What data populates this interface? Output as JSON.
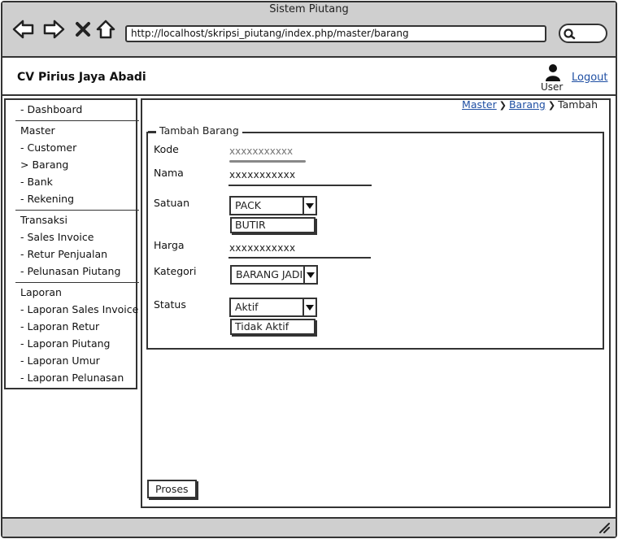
{
  "window": {
    "title": "Sistem Piutang"
  },
  "browser": {
    "url": "http://localhost/skripsi_piutang/index.php/master/barang"
  },
  "header": {
    "brand": "CV Pirius Jaya Abadi",
    "user_label": "User",
    "logout_label": "Logout"
  },
  "breadcrumb": {
    "items": [
      "Master",
      "Barang",
      "Tambah"
    ]
  },
  "sidebar": {
    "dashboard": "- Dashboard",
    "master": {
      "header": "Master",
      "items": [
        "- Customer",
        "> Barang",
        "- Bank",
        "- Rekening"
      ]
    },
    "transaksi": {
      "header": "Transaksi",
      "items": [
        "- Sales Invoice",
        "- Retur Penjualan",
        "- Pelunasan Piutang"
      ]
    },
    "laporan": {
      "header": "Laporan",
      "items": [
        "- Laporan Sales Invoice",
        "- Laporan Retur",
        "- Laporan Piutang",
        "- Laporan Umur",
        "- Laporan Pelunasan"
      ]
    }
  },
  "form": {
    "legend": "Tambah Barang",
    "kode": {
      "label": "Kode",
      "placeholder": "xxxxxxxxxxx"
    },
    "nama": {
      "label": "Nama",
      "value": "xxxxxxxxxxx"
    },
    "satuan": {
      "label": "Satuan",
      "selected": "PACK",
      "options": [
        "BUTIR"
      ]
    },
    "harga": {
      "label": "Harga",
      "value": "xxxxxxxxxxx"
    },
    "kategori": {
      "label": "Kategori",
      "selected": "BARANG JADI"
    },
    "status": {
      "label": "Status",
      "selected": "Aktif",
      "options": [
        "Tidak Aktif"
      ]
    },
    "submit_label": "Proses"
  },
  "colors": {
    "chrome": "#cfcfcf",
    "link": "#1f4fa3",
    "stroke": "#333333"
  }
}
